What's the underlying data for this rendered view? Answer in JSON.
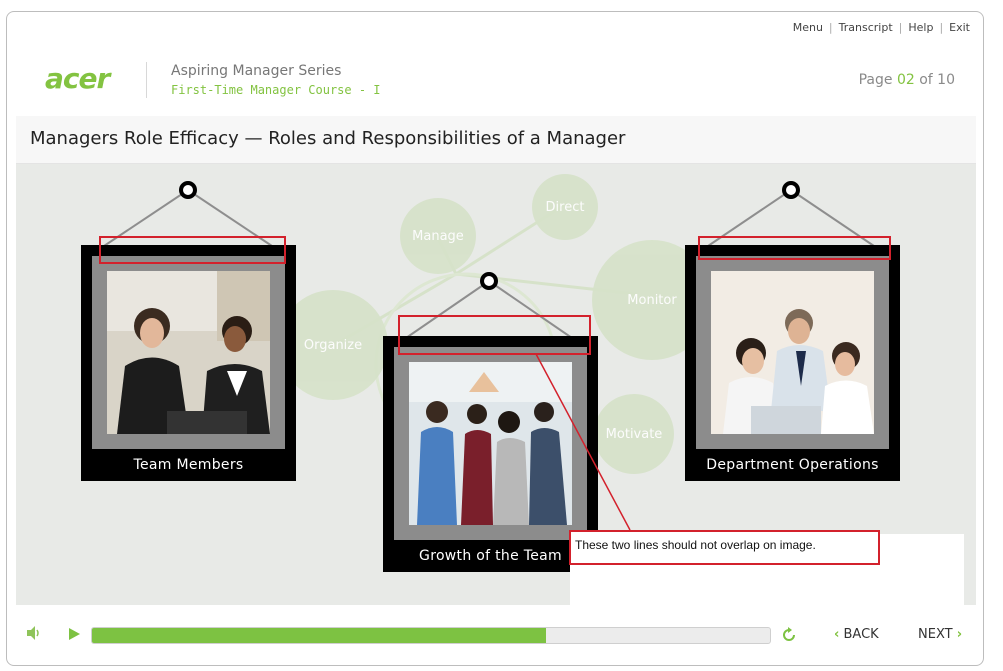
{
  "topnav": {
    "items": [
      "Menu",
      "Transcript",
      "Help",
      "Exit"
    ]
  },
  "brand": {
    "logo": "acer",
    "series": "Aspiring Manager Series",
    "course": "First-Time Manager Course - I",
    "accent": "#83c341"
  },
  "page": {
    "label": "Page",
    "current": "02",
    "of": "of",
    "total": "10"
  },
  "title": "Managers Role Efficacy — Roles and Responsibilities of a Manager",
  "bubbles": [
    "Direct",
    "Manage",
    "Monitor",
    "Organize",
    "Motivate"
  ],
  "frames": [
    {
      "caption": "Team Members"
    },
    {
      "caption": "Growth of the Team"
    },
    {
      "caption": "Department Operations"
    }
  ],
  "annotation": "These two lines should not overlap on image.",
  "controls": {
    "back": "BACK",
    "next": "NEXT",
    "progress": 0.67,
    "progress_color": "#7dc242",
    "annotation_color": "#d3212c"
  }
}
